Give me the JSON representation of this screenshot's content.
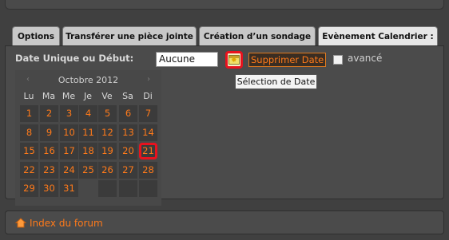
{
  "tabs": [
    {
      "label": "Options"
    },
    {
      "label": "Transférer une pièce jointe"
    },
    {
      "label": "Création d’un sondage"
    },
    {
      "label": "Evènement Calendrier :"
    }
  ],
  "form": {
    "date_label": "Date Unique ou Début:",
    "date_value": "Aucune",
    "delete_label": "Supprimer Date",
    "advanced_label": "avancé",
    "tooltip": "Sélection de Date"
  },
  "calendar": {
    "month": "Octobre 2012",
    "prev": "‹",
    "next": "›",
    "more": "›",
    "weekdays": [
      "Lu",
      "Ma",
      "Me",
      "Je",
      "Ve",
      "Sa",
      "Di"
    ],
    "weeks": [
      [
        "1",
        "2",
        "3",
        "4",
        "5",
        "6",
        "7"
      ],
      [
        "8",
        "9",
        "10",
        "11",
        "12",
        "13",
        "14"
      ],
      [
        "15",
        "16",
        "17",
        "18",
        "19",
        "20",
        "21"
      ],
      [
        "22",
        "23",
        "24",
        "25",
        "26",
        "27",
        "28"
      ],
      [
        "29",
        "30",
        "31",
        "",
        "",
        "",
        ""
      ]
    ],
    "highlighted_day": "21"
  },
  "footer": {
    "forum_link": "Index du forum"
  },
  "colors": {
    "accent": "#ff7a1a",
    "highlight": "#e8121e"
  }
}
